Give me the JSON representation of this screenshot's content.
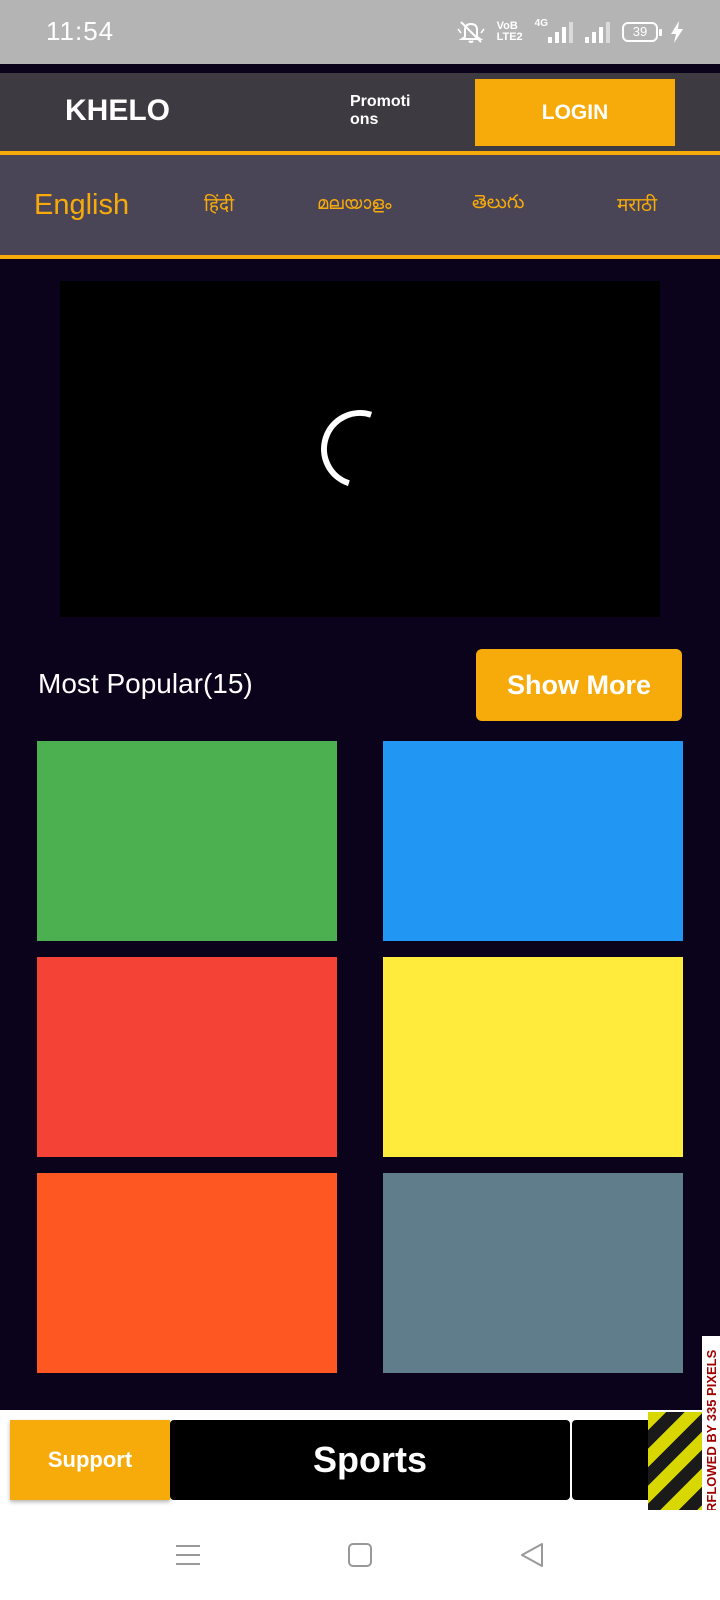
{
  "status_bar": {
    "time": "11:54",
    "volte_top": "VoB",
    "volte_bottom": "LTE2",
    "network": "4G",
    "battery": "39"
  },
  "header": {
    "brand": "KHELO",
    "promotions_label": "Promotions",
    "login_label": "LOGIN"
  },
  "languages": {
    "english": "English",
    "hindi": "हिंदी",
    "malayalam": "മലയാളം",
    "telugu": "తెలుగు",
    "marathi": "मराठी"
  },
  "section": {
    "title": "Most Popular(15)",
    "show_more_label": "Show More"
  },
  "tiles": [
    {
      "color": "#4caf50"
    },
    {
      "color": "#2196f3"
    },
    {
      "color": "#f44336"
    },
    {
      "color": "#ffeb3b"
    },
    {
      "color": "#ff5722"
    },
    {
      "color": "#607d8b"
    }
  ],
  "bottom_bar": {
    "support_label": "Support",
    "sports_label": "Sports",
    "overflow_warning": "RFLOWED BY 335 PIXELS"
  },
  "colors": {
    "accent": "#f6ab0a",
    "background": "#0b021c",
    "header": "#3d3a41",
    "language_bar": "#4a4457"
  }
}
